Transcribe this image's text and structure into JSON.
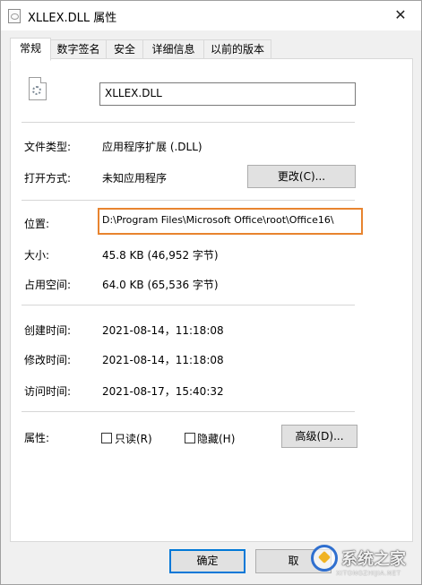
{
  "titlebar": {
    "title": "XLLEX.DLL 属性",
    "close_glyph": "✕"
  },
  "tabs": [
    {
      "label": "常规",
      "active": true
    },
    {
      "label": "数字签名",
      "active": false
    },
    {
      "label": "安全",
      "active": false
    },
    {
      "label": "详细信息",
      "active": false
    },
    {
      "label": "以前的版本",
      "active": false
    }
  ],
  "general": {
    "file_name": "XLLEX.DLL",
    "rows": {
      "type": {
        "label": "文件类型:",
        "value": "应用程序扩展 (.DLL)"
      },
      "opens_with": {
        "label": "打开方式:",
        "value": "未知应用程序",
        "change_button": "更改(C)..."
      },
      "location": {
        "label": "位置:",
        "value": "D:\\Program Files\\Microsoft Office\\root\\Office16\\"
      },
      "size": {
        "label": "大小:",
        "value": "45.8 KB (46,952 字节)"
      },
      "size_on_disk": {
        "label": "占用空间:",
        "value": "64.0 KB (65,536 字节)"
      },
      "created": {
        "label": "创建时间:",
        "value": "2021-08-14，11:18:08"
      },
      "modified": {
        "label": "修改时间:",
        "value": "2021-08-14，11:18:08"
      },
      "accessed": {
        "label": "访问时间:",
        "value": "2021-08-17，15:40:32"
      }
    },
    "attributes": {
      "label": "属性:",
      "readonly_label": "只读(R)",
      "readonly_checked": false,
      "hidden_label": "隐藏(H)",
      "hidden_checked": false,
      "advanced_button": "高级(D)..."
    }
  },
  "footer": {
    "ok_label": "确定",
    "cancel_label": "取"
  },
  "watermark": {
    "text": "系统之家",
    "sub": "XITONGZHIJIA.NET"
  },
  "colors": {
    "highlight": "#e8842f",
    "default_button_border": "#0078d7"
  }
}
